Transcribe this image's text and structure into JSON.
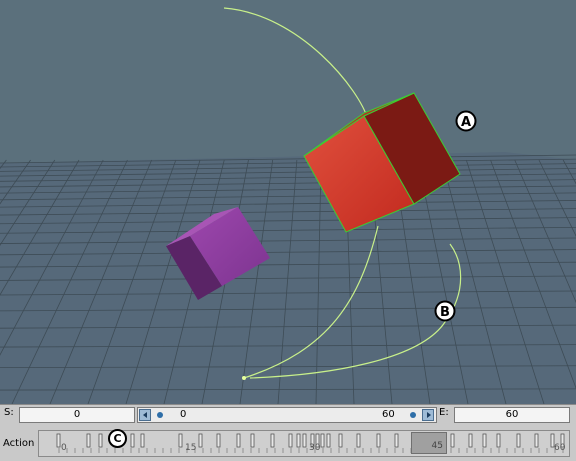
{
  "viewport": {
    "background_color": "#5b707c",
    "grid_color": "#3e4c56",
    "path_color": "#c8f08a",
    "selection_color": "#3dcc33",
    "objects": [
      {
        "name": "red-cube",
        "color": "#d2392a",
        "selected": true
      },
      {
        "name": "purple-cube",
        "color": "#8a3c99",
        "selected": false
      }
    ],
    "callouts": {
      "a": "A",
      "b": "B"
    }
  },
  "timebar": {
    "start_label": "S:",
    "start_value": "0",
    "range_start": "0",
    "range_end": "60",
    "end_label": "E:",
    "end_value": "60",
    "action_label": "Action",
    "current_frame": "45",
    "ticks": [
      "0",
      "15",
      "30",
      "45",
      "60"
    ],
    "callout_c": "C"
  }
}
